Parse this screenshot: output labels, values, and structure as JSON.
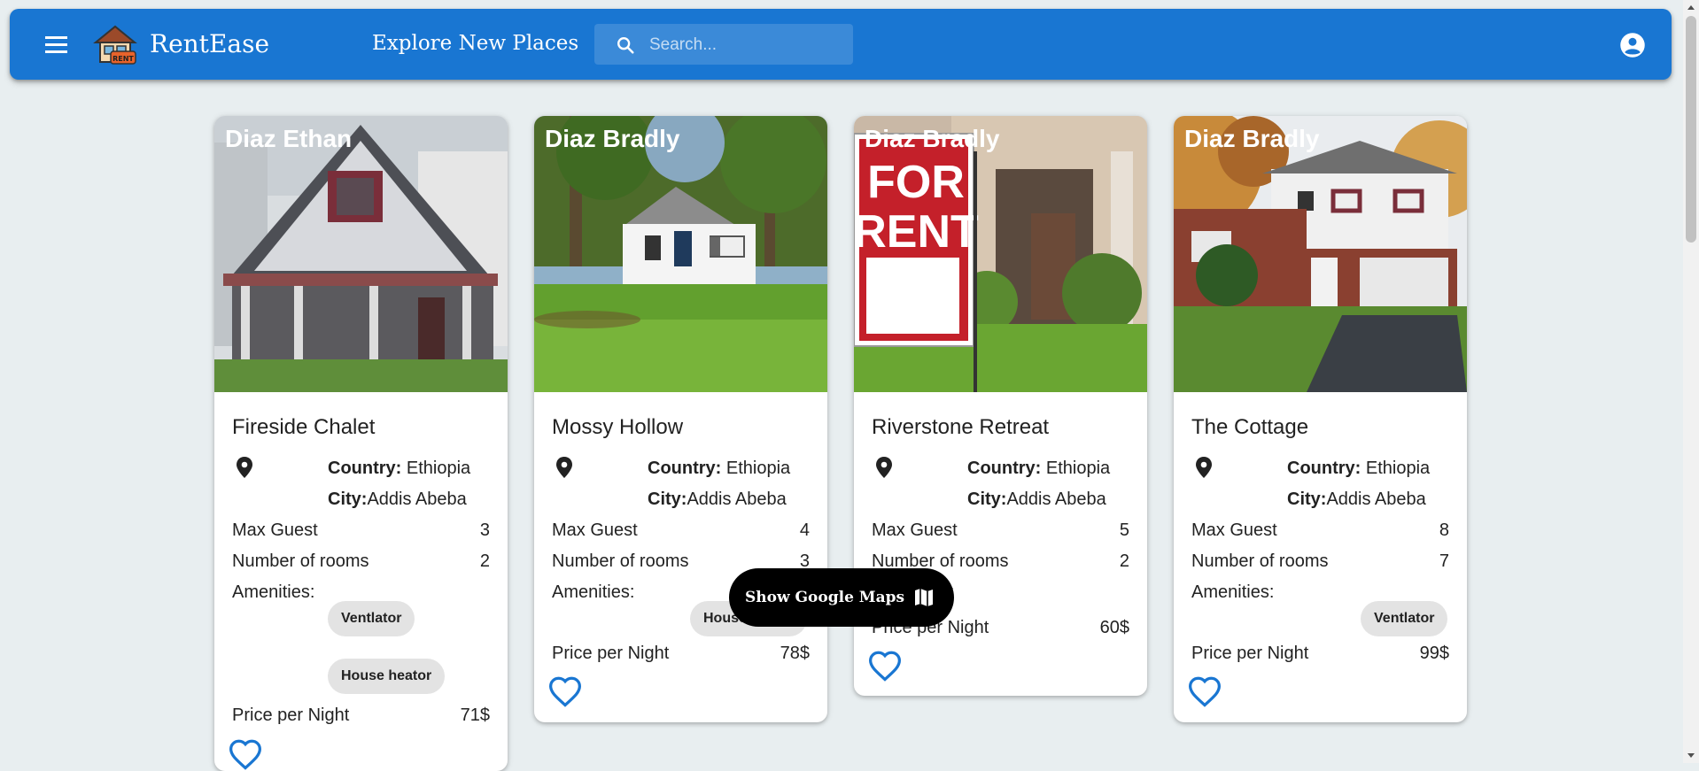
{
  "app": {
    "brand": "RentEase",
    "page_heading": "Explore New Places",
    "search_placeholder": "Search...",
    "accent_color": "#1976d2"
  },
  "icons": {
    "menu": "menu-icon",
    "logo": "house-rent-logo",
    "search": "search-icon",
    "account": "account-circle-icon",
    "location": "location-pin-icon",
    "favorite": "heart-outline-icon",
    "map": "map-icon"
  },
  "labels": {
    "country": "Country:",
    "city": "City:",
    "max_guest": "Max Guest",
    "rooms": "Number of rooms",
    "amenities": "Amenities:",
    "price": "Price per Night"
  },
  "listings": [
    {
      "owner": "Diaz Ethan",
      "title": "Fireside Chalet",
      "country": "Ethiopia",
      "city": "Addis Abeba",
      "max_guest": "3",
      "rooms": "2",
      "amenities": [
        "Ventlator",
        "House heator"
      ],
      "price": "71$"
    },
    {
      "owner": "Diaz Bradly",
      "title": "Mossy Hollow",
      "country": "Ethiopia",
      "city": "Addis Abeba",
      "max_guest": "4",
      "rooms": "3",
      "amenities": [
        "House heator"
      ],
      "price": "78$"
    },
    {
      "owner": "Diaz Bradly",
      "title": "Riverstone Retreat",
      "country": "Ethiopia",
      "city": "Addis Abeba",
      "max_guest": "5",
      "rooms": "2",
      "amenities": [],
      "price": "60$"
    },
    {
      "owner": "Diaz Bradly",
      "title": "The Cottage",
      "country": "Ethiopia",
      "city": "Addis Abeba",
      "max_guest": "8",
      "rooms": "7",
      "amenities": [
        "Ventlator"
      ],
      "price": "99$"
    }
  ],
  "sign_text": [
    "FOR",
    "RENT"
  ],
  "maps_button": {
    "label": "Show Google Maps"
  }
}
